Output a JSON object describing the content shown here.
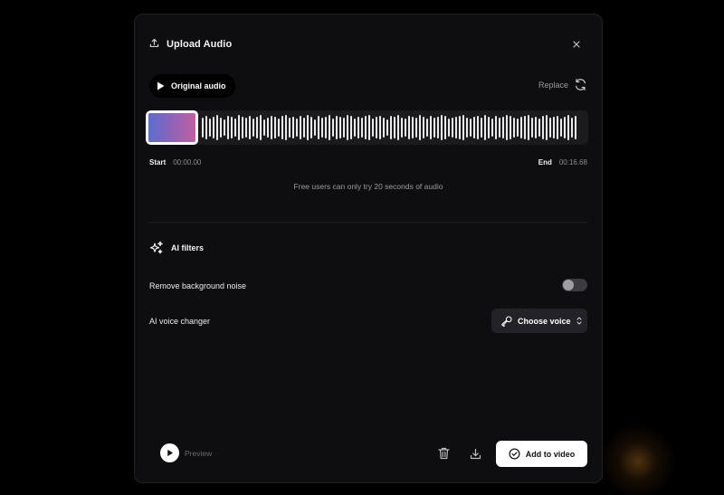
{
  "dialog": {
    "title": "Upload Audio",
    "close_icon": "close-icon",
    "upload_icon": "upload-icon"
  },
  "audio": {
    "original_label": "Original audio",
    "replace_label": "Replace",
    "start_label": "Start",
    "start_time": "00:00.00",
    "end_label": "End",
    "end_time": "00:16.68",
    "notice": "Free users can only try 20 seconds of audio"
  },
  "filters": {
    "title": "AI filters",
    "remove_noise_label": "Remove background noise",
    "remove_noise_enabled": false,
    "voice_changer_label": "AI voice changer",
    "choose_voice_label": "Choose voice"
  },
  "footer": {
    "preview_label": "Preview",
    "add_label": "Add to video"
  },
  "colors": {
    "modal_bg": "#0e0e10",
    "waveform_bg": "#1b1b1e",
    "accent_gradient_start": "#5a6fd0",
    "accent_gradient_end": "#c060a0"
  }
}
